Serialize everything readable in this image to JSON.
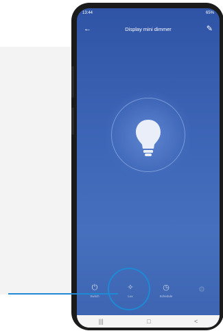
{
  "status_bar": {
    "time": "13:44",
    "right": "65%"
  },
  "header": {
    "back_icon": "arrow-left-icon",
    "title": "Display mini dimmer",
    "edit_icon": "pencil-icon"
  },
  "bulb": {
    "icon": "lightbulb-icon"
  },
  "tabs": [
    {
      "icon": "power-icon",
      "label": "Switch"
    },
    {
      "icon": "brightness-icon",
      "label": "Lux"
    },
    {
      "icon": "clock-icon",
      "label": "Schedule"
    },
    {
      "icon": "settings-icon",
      "label": ""
    }
  ],
  "nav": {
    "recent": "|||",
    "home": "□",
    "back": "<"
  },
  "colors": {
    "accent": "#1e8ad6",
    "screen_top": "#2f54a6",
    "screen_bottom": "#3c63b0"
  }
}
